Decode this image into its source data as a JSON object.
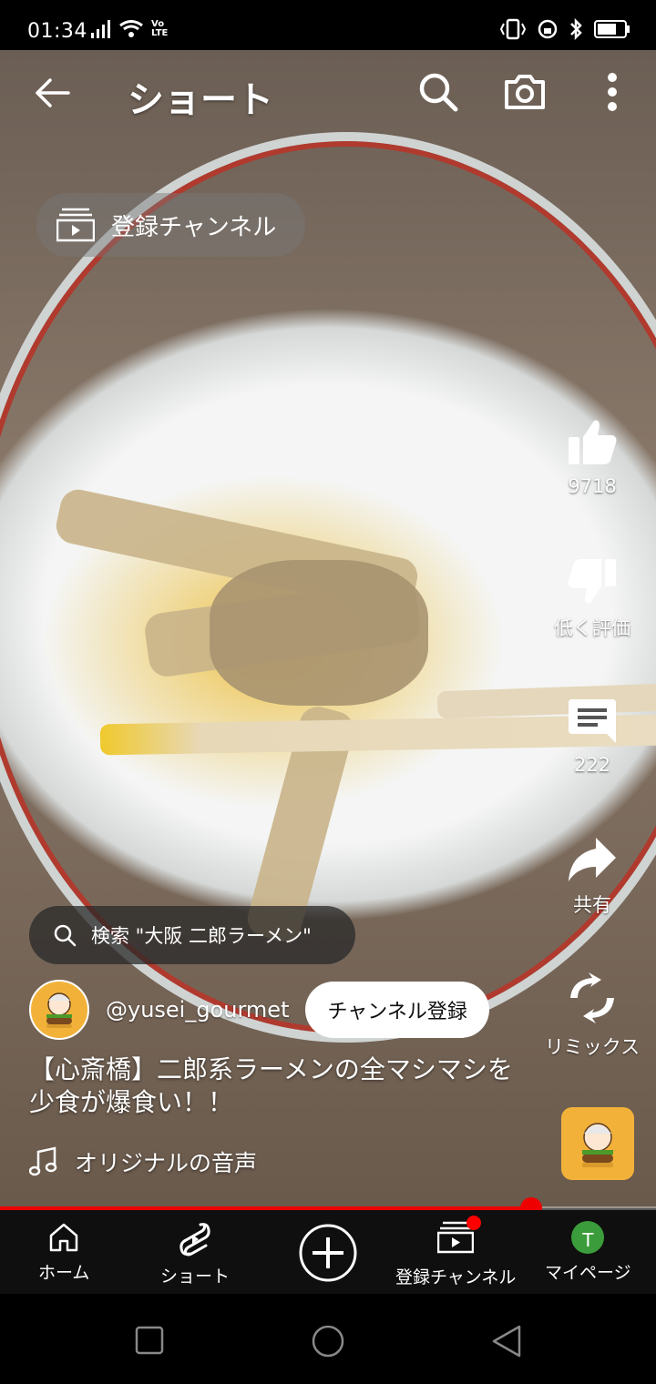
{
  "status_bar": {
    "time": "01:34",
    "network_label": "Vo LTE"
  },
  "header": {
    "title": "ショート"
  },
  "subscriptions_pill": {
    "label": "登録チャンネル"
  },
  "actions": {
    "like_count": "9718",
    "dislike_label": "低く評価",
    "comment_count": "222",
    "share_label": "共有",
    "remix_label": "リミックス"
  },
  "search_pill": {
    "label": "検索 \"大阪 二郎ラーメン\""
  },
  "channel": {
    "handle": "@yusei_gourmet",
    "subscribe_label": "チャンネル登録"
  },
  "video": {
    "caption": "【心斎橋】二郎系ラーメンの全マシマシを少食が爆食い！！",
    "audio_label": "オリジナルの音声",
    "progress": 0.81
  },
  "bottom_nav": {
    "home": "ホーム",
    "shorts": "ショート",
    "subscriptions": "登録チャンネル",
    "mypage": "マイページ",
    "account_initial": "T"
  },
  "colors": {
    "accent": "#ff0000",
    "nav_bg": "#0f0f0f",
    "account_badge": "#3a9c3a"
  },
  "icons": [
    "back-arrow-icon",
    "search-icon",
    "camera-icon",
    "more-vert-icon",
    "subscriptions-icon",
    "thumb-up-icon",
    "thumb-down-icon",
    "comment-icon",
    "share-icon",
    "remix-icon",
    "music-note-icon",
    "home-icon",
    "shorts-icon",
    "create-plus-icon",
    "square-icon",
    "circle-icon",
    "triangle-back-icon"
  ]
}
